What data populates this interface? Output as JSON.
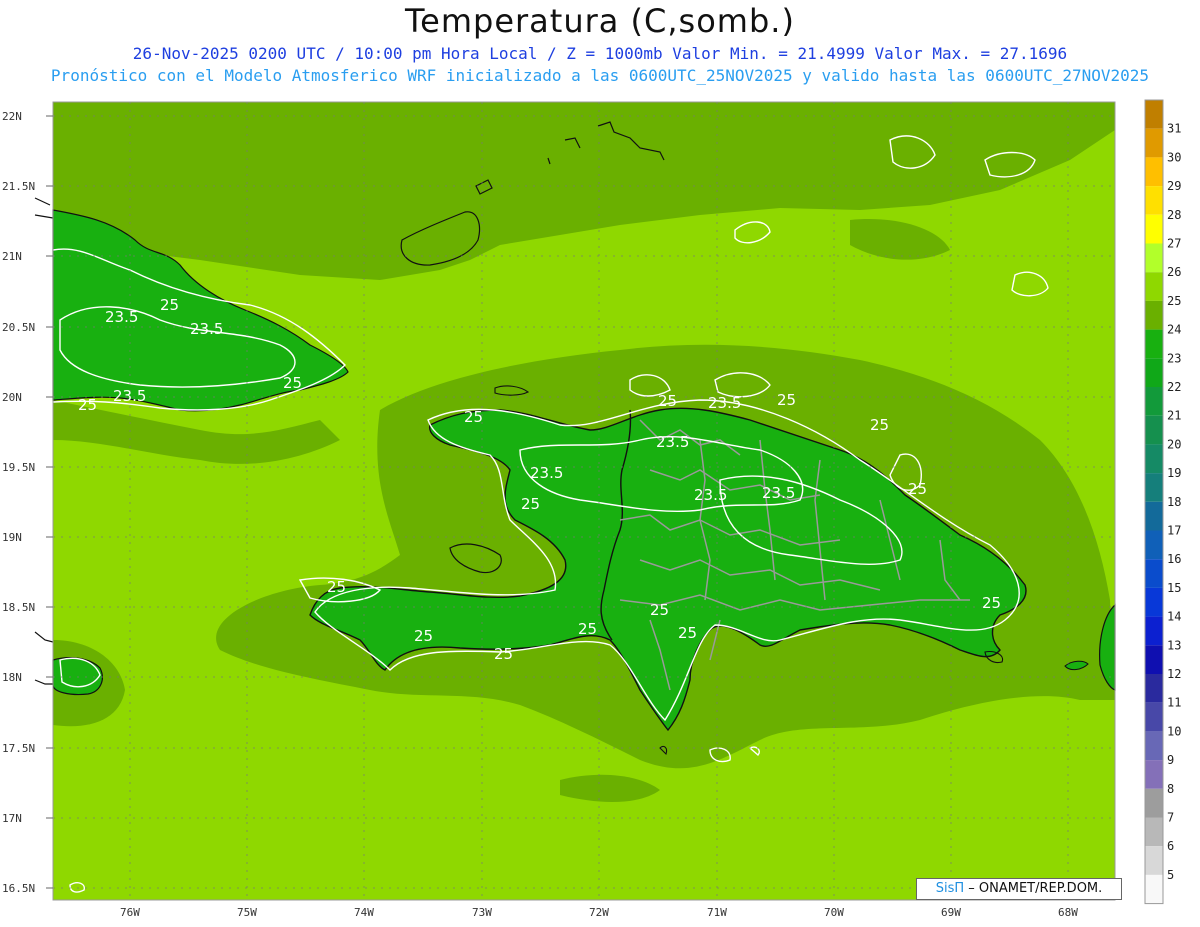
{
  "header": {
    "title": "Temperatura (C,somb.)",
    "line1": "26-Nov-2025 0200 UTC / 10:00 pm Hora Local / Z = 1000mb  Valor Min. = 21.4999  Valor Max. = 27.1696",
    "line2": "Pronóstico con el Modelo Atmosferico WRF inicializado a las 0600UTC_25NOV2025 y valido hasta las  0600UTC_27NOV2025"
  },
  "axes": {
    "y_labels": [
      "22N",
      "21.5N",
      "21N",
      "20.5N",
      "20N",
      "19.5N",
      "19N",
      "18.5N",
      "18N",
      "17.5N",
      "17N",
      "16.5N"
    ],
    "x_labels": [
      "76W",
      "75W",
      "74W",
      "73W",
      "72W",
      "71W",
      "70W",
      "69W",
      "68W"
    ]
  },
  "contour_labels": [
    "25",
    "23.5",
    "25",
    "23.5",
    "25",
    "23.5",
    "25",
    "25",
    "23.5",
    "25",
    "25",
    "23.5",
    "23.5",
    "23.5",
    "25",
    "23.5",
    "25",
    "25",
    "25",
    "25",
    "25",
    "25",
    "25",
    "25"
  ],
  "colorbar": {
    "levels": [
      "31",
      "30",
      "29",
      "28",
      "27",
      "26",
      "25",
      "24",
      "23",
      "22",
      "21",
      "20",
      "19",
      "18",
      "17",
      "16",
      "15",
      "14",
      "13",
      "12",
      "11",
      "10",
      "9",
      "8",
      "7",
      "6",
      "5"
    ],
    "colors": [
      "#c07f00",
      "#e09a00",
      "#ffbf00",
      "#ffe000",
      "#ffff00",
      "#b2ff2a",
      "#8fd800",
      "#6ab000",
      "#18b010",
      "#10a818",
      "#129a3a",
      "#15904e",
      "#158a65",
      "#157f7b",
      "#136a9a",
      "#1060b8",
      "#0a4ccc",
      "#0838d8",
      "#0c20d0",
      "#0f0fb0",
      "#2a2a9e",
      "#4848a8",
      "#6868b6",
      "#8470b8",
      "#9d9d9d",
      "#b8b8b8",
      "#d8d8d8",
      "#f8f8f8"
    ]
  },
  "credit": {
    "sis": "SisΠ",
    "rest": " –  ONAMET/REP.DOM."
  },
  "colors": {
    "sea": "#8fd800",
    "band": "#6ab000",
    "land": "#18b010",
    "land_dark": "#10a818"
  }
}
